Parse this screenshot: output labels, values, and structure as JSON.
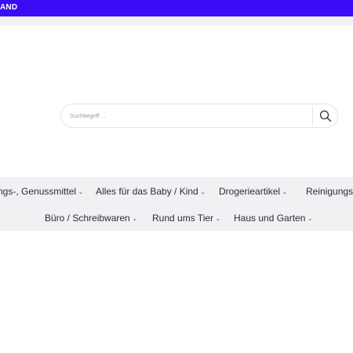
{
  "topbar": {
    "text": "AND"
  },
  "search": {
    "placeholder": "Suchbegriff ..."
  },
  "nav": {
    "row1": [
      {
        "label": "ngs-, Genussmittel"
      },
      {
        "label": "Alles für das Baby / Kind"
      },
      {
        "label": "Drogerieartikel"
      },
      {
        "label": "Reinigungs"
      }
    ],
    "row2": [
      {
        "label": "Büro / Schreibwaren"
      },
      {
        "label": "Rund ums Tier"
      },
      {
        "label": "Haus und Garten"
      }
    ],
    "caret": "⌄"
  },
  "colors": {
    "topbar": "#3a0cf5",
    "nav_bg": "#f1f1f4"
  },
  "icons": {
    "search": "search-icon"
  }
}
